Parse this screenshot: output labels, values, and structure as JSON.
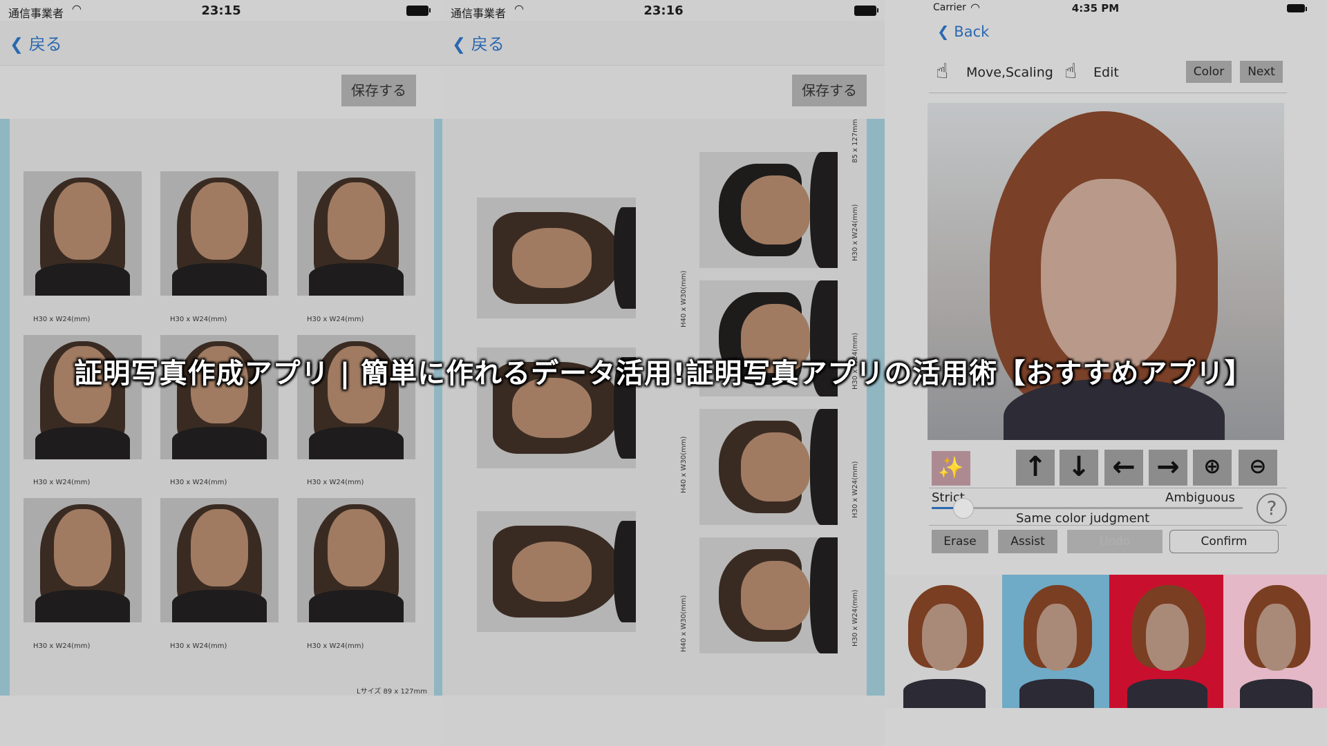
{
  "colors": {
    "accent": "#2a68b0",
    "edge": "#90b6c2",
    "overlay_text": "#ffffff"
  },
  "overlay_title": "証明写真作成アプリ | 簡単に作れるデータ活用!証明写真アプリの活用術【おすすめアプリ】",
  "panel1": {
    "status": {
      "carrier": "通信事業者",
      "time": "23:15"
    },
    "back_label": "戻る",
    "save_label": "保存する",
    "photo_caption": "H30 x W24(mm)",
    "sheet_label": "Lサイズ 89 x 127mm"
  },
  "panel2": {
    "status": {
      "carrier": "通信事業者",
      "time": "23:16"
    },
    "back_label": "戻る",
    "save_label": "保存する",
    "large_caption": "H40 x W30(mm)",
    "small_caption": "H30 x W24(mm)",
    "sheet_label": "85 x 127mm"
  },
  "panel3": {
    "status": {
      "carrier": "Carrier",
      "time": "4:35 PM"
    },
    "back_label": "Back",
    "toolbar": {
      "move_label": "Move,Scaling",
      "edit_label": "Edit",
      "color_label": "Color",
      "next_label": "Next"
    },
    "icons": {
      "move": "hand-pointer-icon",
      "edit": "hand-pointer-icon",
      "magic": "magic-wand-icon",
      "help": "question-icon"
    },
    "arrows": [
      "↑",
      "↓",
      "←",
      "→"
    ],
    "zoom": {
      "in": "zoom-in-icon",
      "out": "zoom-out-icon"
    },
    "slider": {
      "left_label": "Strict",
      "right_label": "Ambiguous",
      "caption": "Same color judgment",
      "value": 0.1
    },
    "buttons": {
      "erase": "Erase",
      "assist": "Assist",
      "undo": "Undo",
      "confirm": "Confirm"
    },
    "background_colors": [
      "#cfcfcf",
      "#6faac6",
      "#c8102e",
      "#e4b8c6"
    ]
  }
}
